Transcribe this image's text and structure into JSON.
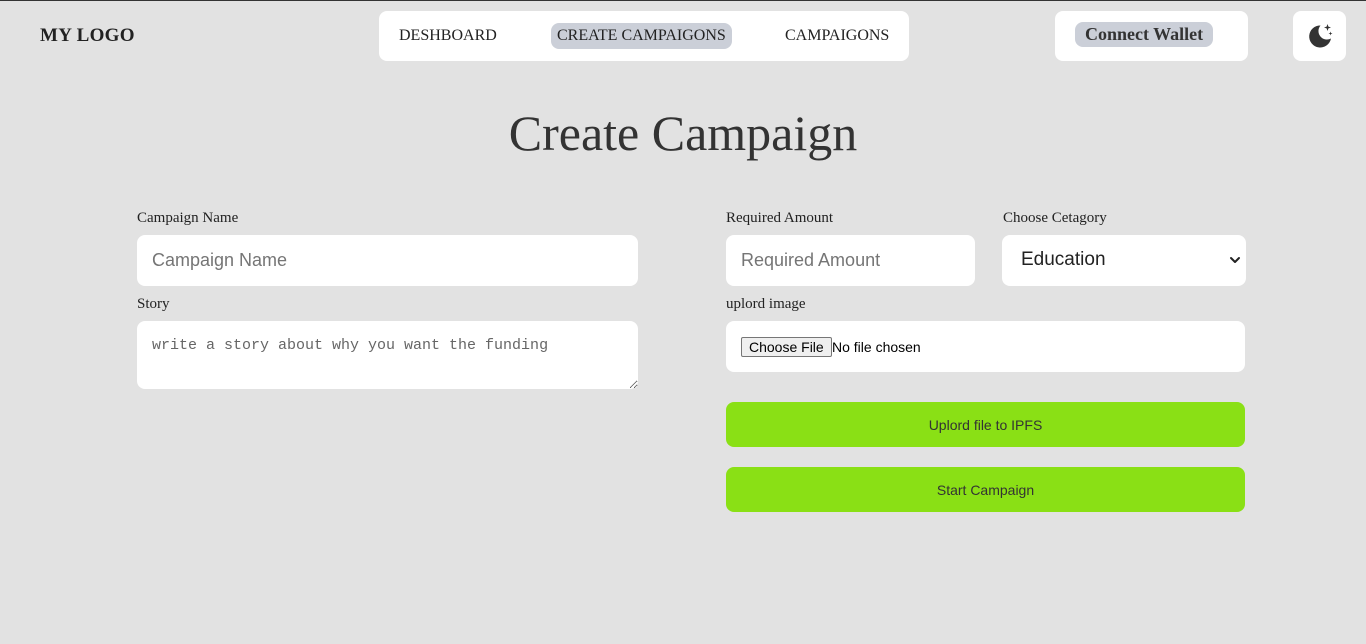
{
  "header": {
    "logo": "MY LOGO",
    "nav": [
      {
        "label": "DESHBOARD"
      },
      {
        "label": "CREATE CAMPAIGONS",
        "active": true
      },
      {
        "label": "CAMPAIGONS"
      }
    ],
    "wallet_button": "Connect Wallet",
    "theme_toggle_icon": "moon-stars-icon"
  },
  "main": {
    "title": "Create Campaign",
    "campaign_name": {
      "label": "Campaign Name",
      "placeholder": "Campaign Name",
      "value": ""
    },
    "story": {
      "label": "Story",
      "placeholder": "write a story about why you want the funding",
      "value": ""
    },
    "required_amount": {
      "label": "Required Amount",
      "placeholder": "Required Amount",
      "value": ""
    },
    "category": {
      "label": "Choose Cetagory",
      "selected": "Education"
    },
    "upload_image": {
      "label": "uplord image",
      "button": "Choose File",
      "status": "No file chosen"
    },
    "upload_ipfs_button": "Uplord file to IPFS",
    "start_button": "Start Campaign"
  },
  "colors": {
    "background": "#e2e2e2",
    "panel": "#ffffff",
    "active_nav": "#cbcfd8",
    "accent_green": "#8ae015"
  }
}
